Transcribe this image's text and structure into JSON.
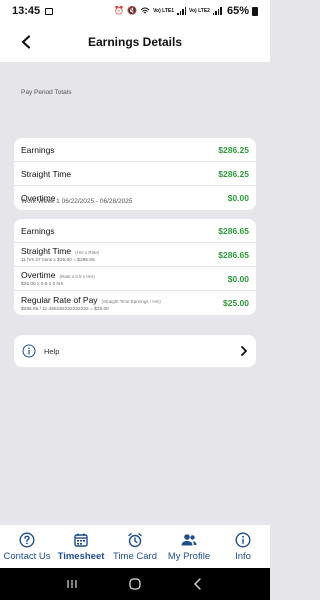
{
  "status_bar": {
    "time": "13:45",
    "network_1": "Vo) LTE1",
    "network_2": "Vo) LTE2",
    "battery": "65%"
  },
  "header": {
    "title": "Earnings Details",
    "back_icon": "chevron-left-icon"
  },
  "pay_period": {
    "label": "Pay Period Totals",
    "rows": [
      {
        "label": "Earnings",
        "value": "$286.25"
      },
      {
        "label": "Straight Time",
        "value": "$286.25"
      },
      {
        "label": "Overtime",
        "value": "$0.00"
      }
    ]
  },
  "work_week": {
    "label": "Work Week 1 06/22/2025 - 06/28/2025",
    "earnings": {
      "label": "Earnings",
      "value": "$286.65"
    },
    "straight_time": {
      "label": "Straight Time",
      "hint": "(Hrs x Rate)",
      "sub": "11 hrs 27 mins x $25.00 = $286.65",
      "value": "$286.65"
    },
    "overtime": {
      "label": "Overtime",
      "hint": "(Rate x 0.5 x Hrs)",
      "sub": "$25.00 x 0.5 x 0 hrs",
      "value": "$0.00"
    },
    "regular_rate": {
      "label": "Regular Rate of Pay",
      "hint": "(Straight Time Earnings / Hrs)",
      "sub": "$286.65 / 11.466192222222222 = $25.00",
      "value": "$25.00"
    }
  },
  "help": {
    "label": "Help",
    "icon": "info-icon",
    "chevron": "chevron-right-icon"
  },
  "tabs": [
    {
      "label": "Contact Us",
      "icon": "question-circle-icon",
      "active": false
    },
    {
      "label": "Timesheet",
      "icon": "calendar-icon",
      "active": true
    },
    {
      "label": "Time Card",
      "icon": "alarm-clock-icon",
      "active": false
    },
    {
      "label": "My Profile",
      "icon": "people-icon",
      "active": false
    },
    {
      "label": "Info",
      "icon": "info-icon",
      "active": false
    }
  ],
  "colors": {
    "accent": "#1f4e8c",
    "money_green": "#2e9c3a",
    "background": "#e6e6ea"
  }
}
